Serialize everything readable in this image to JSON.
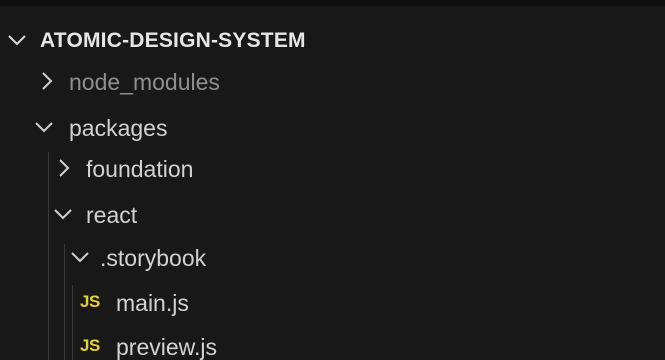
{
  "explorer": {
    "section_title": "ATOMIC-DESIGN-SYSTEM",
    "items": [
      {
        "label": "node_modules",
        "state": "collapsed",
        "depth": 1
      },
      {
        "label": "packages",
        "state": "expanded",
        "depth": 1
      },
      {
        "label": "foundation",
        "state": "collapsed",
        "depth": 2
      },
      {
        "label": "react",
        "state": "expanded",
        "depth": 2
      },
      {
        "label": ".storybook",
        "state": "expanded",
        "depth": 3
      },
      {
        "label": "main.js",
        "type": "file",
        "file_icon": "JS",
        "depth": 4
      },
      {
        "label": "preview.js",
        "type": "file",
        "file_icon": "JS",
        "depth": 4
      }
    ]
  },
  "colors": {
    "background": "#181818",
    "text": "#d2d2d2",
    "dim_text": "#8f8f8f",
    "js_icon": "#e6cf3b",
    "indent_guide": "#3a3a3a"
  }
}
